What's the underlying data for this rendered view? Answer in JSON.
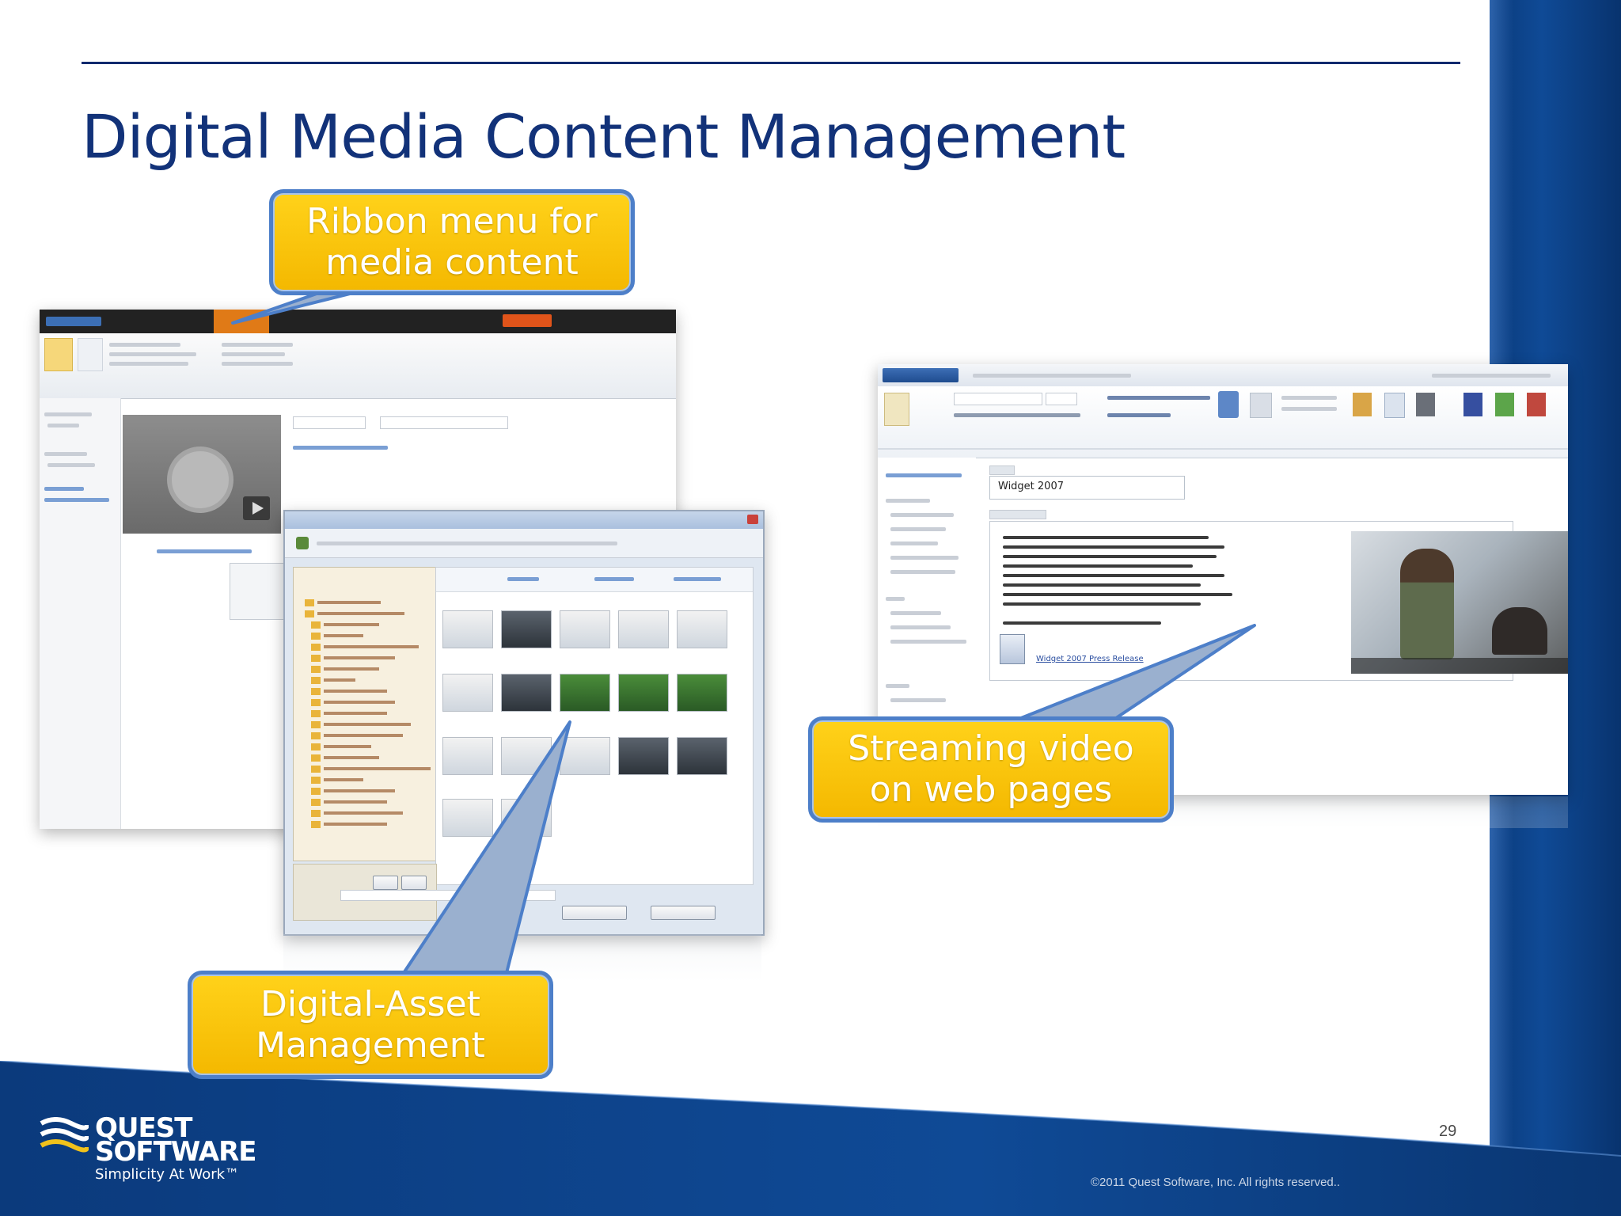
{
  "slide": {
    "title": "Digital Media Content Management",
    "page_number": "29",
    "copyright": "©2011 Quest Software, Inc. All rights reserved..",
    "colors": {
      "title": "#123279",
      "callout_fill": "#ffc800",
      "callout_border": "#4d7fc9",
      "band": "#0f4a96"
    }
  },
  "callouts": {
    "ribbon": [
      "Ribbon menu for",
      "media content"
    ],
    "streaming": [
      "Streaming video",
      "on web pages"
    ],
    "dam": [
      "Digital-Asset",
      "Management"
    ]
  },
  "screens": {
    "right_title_value": "Widget 2007",
    "right_link": "Widget 2007 Press Release"
  },
  "logo": {
    "line1": "QUEST",
    "line2": "SOFTWARE",
    "tagline": "Simplicity At Work™",
    "icon": "quest-wave-icon"
  }
}
